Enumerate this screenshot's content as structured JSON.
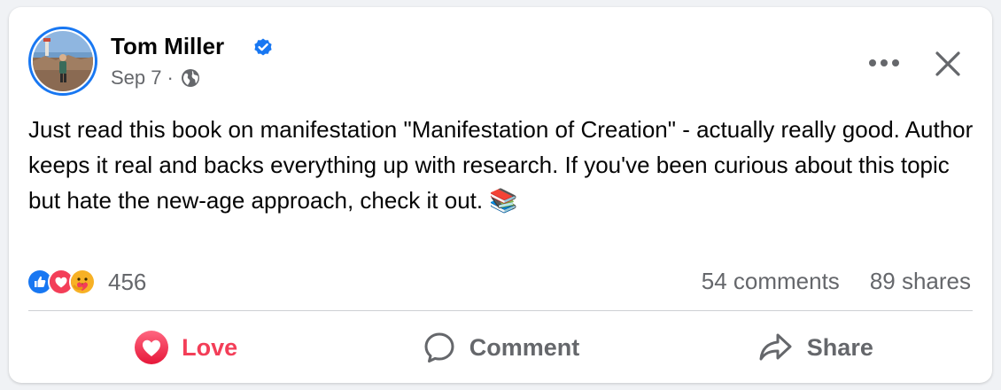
{
  "post": {
    "author": "Tom Miller",
    "date": "Sep 7",
    "dot": "·",
    "text": "Just read this book on manifestation \"Manifestation of Creation\" - actually really good. Author keeps it real and backs everything up with research. If you've been curious about this topic but hate the new-age approach, check it out. 📚"
  },
  "icons": {
    "verified": "verified-badge-icon",
    "audience": "globe-icon",
    "more": "more-horizontal-icon",
    "close": "close-icon",
    "reactions": [
      "like-reaction-icon",
      "love-reaction-icon",
      "care-reaction-icon"
    ]
  },
  "engagement": {
    "reaction_count": "456",
    "comments": "54 comments",
    "shares": "89 shares"
  },
  "actions": {
    "love": "Love",
    "comment": "Comment",
    "share": "Share"
  },
  "colors": {
    "accent": "#1877f2",
    "love": "#f33e58",
    "secondary_text": "#65676b"
  }
}
